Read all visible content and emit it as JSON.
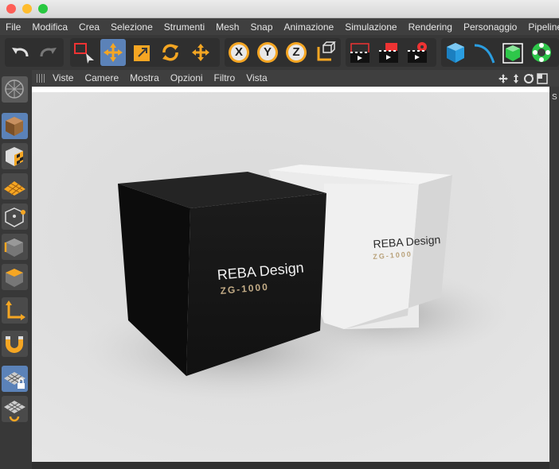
{
  "window": {
    "traffic_lights": {
      "close": "#fe5f57",
      "minimize": "#febc2e",
      "zoom": "#28c840"
    }
  },
  "menu": {
    "items": [
      "File",
      "Modifica",
      "Crea",
      "Selezione",
      "Strumenti",
      "Mesh",
      "Snap",
      "Animazione",
      "Simulazione",
      "Rendering",
      "Personaggio",
      "Pipeline"
    ]
  },
  "toolbar": {
    "x_label": "X",
    "y_label": "Y",
    "z_label": "Z",
    "accent": "#f5a623",
    "selected_bg": "#5b82b8"
  },
  "view_header": {
    "items": [
      "Viste",
      "Camere",
      "Mostra",
      "Opzioni",
      "Filtro",
      "Vista"
    ]
  },
  "scene": {
    "black_cube": {
      "title": "REBA Design",
      "model": "ZG-1000"
    },
    "white_cube": {
      "title": "REBA Design",
      "model": "ZG-1000"
    }
  },
  "right_panel": {
    "label": "S"
  }
}
